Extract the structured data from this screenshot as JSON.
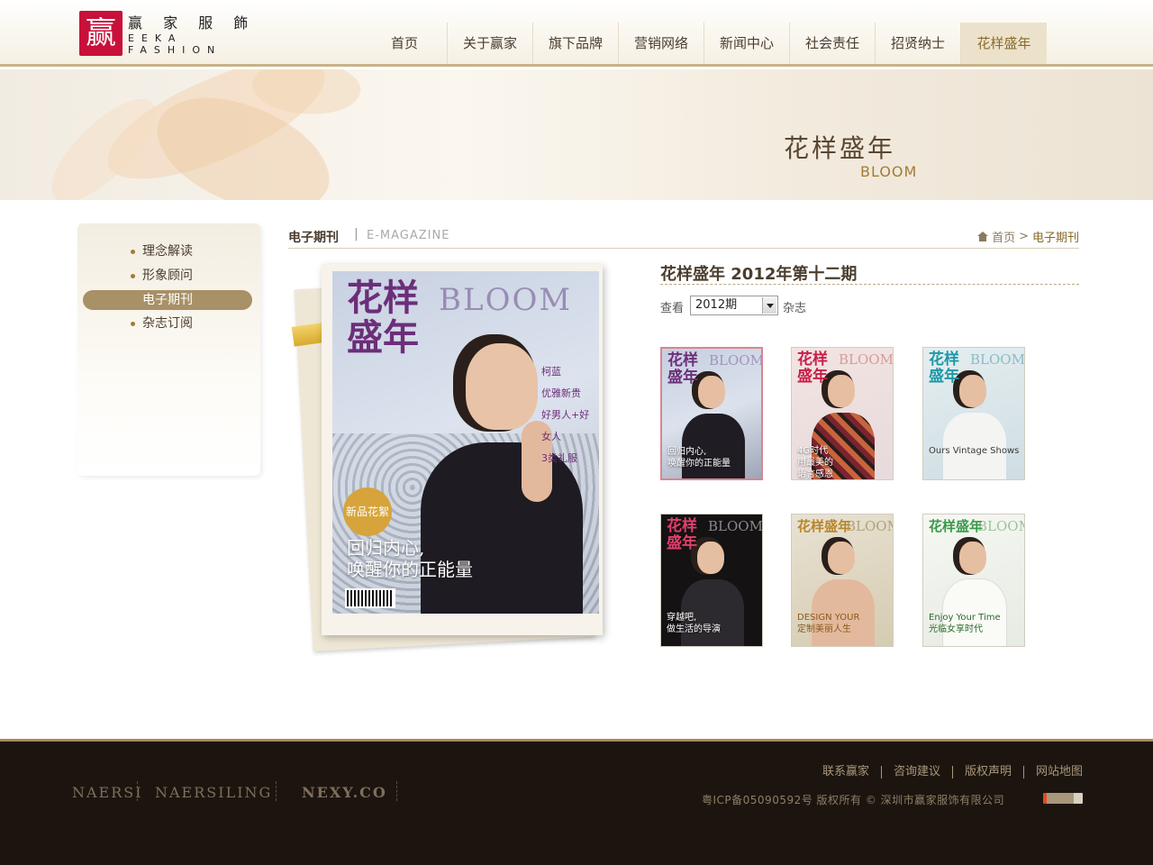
{
  "logo": {
    "mark": "赢",
    "cn": "赢 家 服 飾",
    "en1": "EEKA",
    "en2": "FASHION"
  },
  "nav": {
    "items": [
      {
        "label": "首页"
      },
      {
        "label": "关于赢家"
      },
      {
        "label": "旗下品牌"
      },
      {
        "label": "营销网络"
      },
      {
        "label": "新闻中心"
      },
      {
        "label": "社会责任"
      },
      {
        "label": "招贤纳士"
      },
      {
        "label": "花样盛年",
        "active": true
      }
    ]
  },
  "banner": {
    "title_cn": "花样盛年",
    "title_en": "BLOOM"
  },
  "side_menu": {
    "items": [
      {
        "label": "理念解读"
      },
      {
        "label": "形象顾问"
      },
      {
        "label": "电子期刊",
        "active": true
      },
      {
        "label": "杂志订阅"
      }
    ]
  },
  "content": {
    "title": "电子期刊",
    "separator": "|",
    "title_en": "E-MAGAZINE",
    "breadcrumb": {
      "home": "首页",
      "arrow": ">",
      "current": "电子期刊"
    }
  },
  "big_cover": {
    "title_top": "花样",
    "title_bottom": "盛年",
    "bloom": "BLOOM",
    "badge": "新品花絮",
    "headline_1": "回归内心,",
    "headline_2": "唤醒你的正能量",
    "side_name": "柯蓝",
    "side_lines": [
      "优雅新贵",
      "好男人+好女人",
      "3类礼服"
    ]
  },
  "issue": {
    "title": "花样盛年 2012年第十二期",
    "view_label": "查看",
    "selected_year": "2012期",
    "view_suffix": "杂志"
  },
  "thumbnails": [
    {
      "title": "花样\n盛年",
      "bloom": "BLOOM",
      "caption": "回归内心,\n唤醒你的正能量",
      "active": true
    },
    {
      "title": "花样\n盛年",
      "bloom": "BLOOM",
      "caption": "4G时代\n用最美的\n语言感恩"
    },
    {
      "title": "花样\n盛年",
      "bloom": "BLOOM",
      "caption": "Ours Vintage Shows"
    },
    {
      "title": "花样\n盛年",
      "bloom": "BLOOM",
      "caption": "穿越吧,\n做生活的导演"
    },
    {
      "title": "花样盛年",
      "bloom": "BLOOM",
      "caption": "DESIGN YOUR\n定制美丽人生"
    },
    {
      "title": "花样盛年",
      "bloom": "BLOOM",
      "caption": "Enjoy Your Time\n光临女享时代"
    }
  ],
  "footer": {
    "brands": [
      "NAERSI",
      "NAERSILING",
      "NEXY.CO"
    ],
    "links": [
      "联系赢家",
      "咨询建议",
      "版权声明",
      "网站地图"
    ],
    "copyright": "粤ICP备05090592号 版权所有 © 深圳市赢家服饰有限公司"
  },
  "colors": {
    "accent_gold": "#a27c35",
    "active_menu": "#a89067",
    "logo_red": "#c8103a",
    "footer_bg": "#1c150f"
  }
}
